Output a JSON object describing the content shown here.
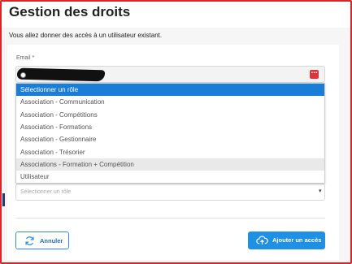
{
  "header": {
    "title": "Gestion des droits"
  },
  "intro": {
    "text": "Vous allez donner des accès à un utilisateur existant."
  },
  "email": {
    "label": "Email *",
    "value": ""
  },
  "role_dropdown": {
    "options": [
      "Sélectionner un rôle",
      "Association - Communication",
      "Association - Compétitions",
      "Association - Formations",
      "Association - Gestionnaire",
      "Association - Trésorier",
      "Associations - Formation + Compétition",
      "Utilisateur"
    ],
    "selected_index": 0,
    "hovered_index": 6
  },
  "role_select": {
    "placeholder": "Sélectionner un rôle"
  },
  "actions": {
    "cancel_label": "Annuler",
    "add_label": "Ajouter un accès"
  },
  "colors": {
    "accent": "#1e90e6",
    "selected": "#1b7ed6",
    "danger": "#e0343a",
    "frame": "#e0202a"
  },
  "icons": {
    "cancel": "refresh-icon",
    "add": "cloud-upload-icon",
    "email_action": "more-icon",
    "select": "chevron-down-icon"
  }
}
